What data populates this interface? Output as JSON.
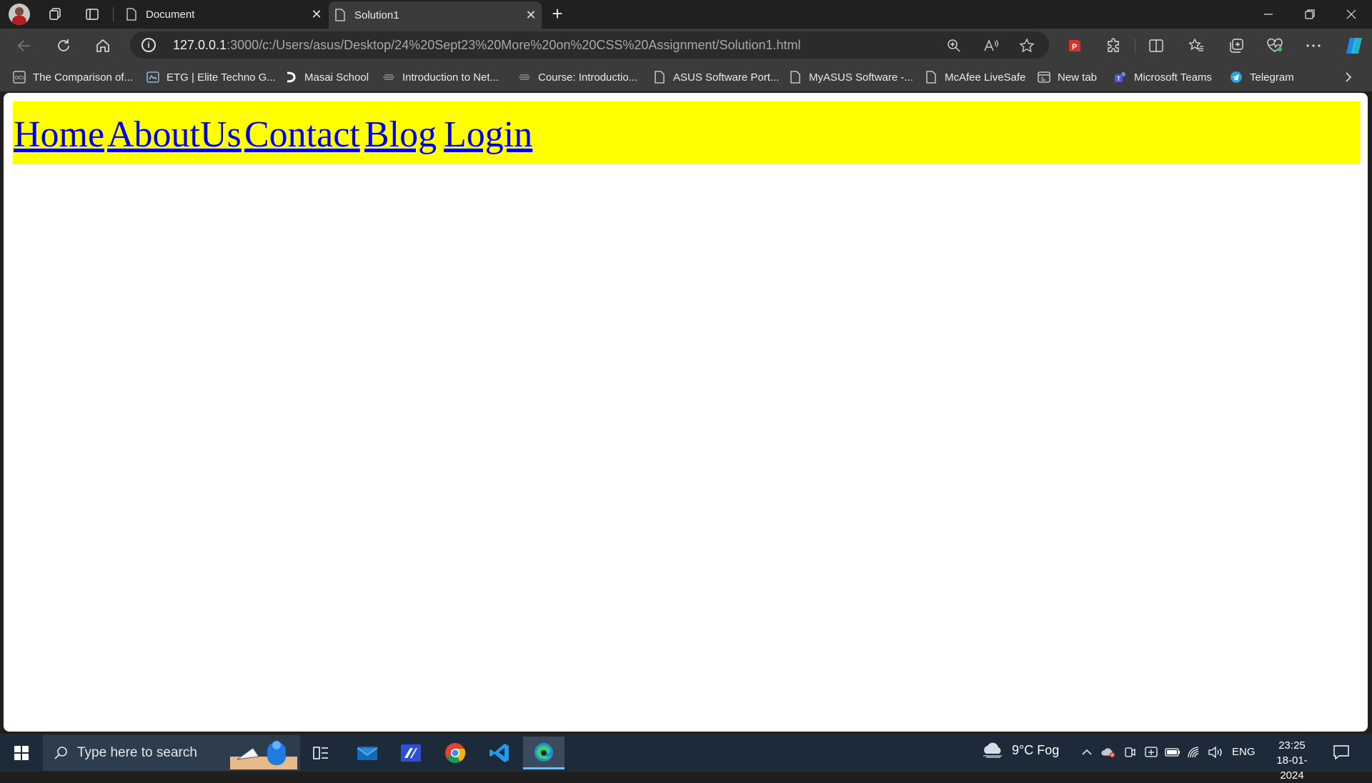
{
  "browser": {
    "tabs": [
      {
        "title": "Document",
        "active": false
      },
      {
        "title": "Solution1",
        "active": true
      }
    ],
    "address": {
      "host": "127.0.0.1",
      "path": ":3000/c:/Users/asus/Desktop/24%20Sept23%20More%20on%20CSS%20Assignment/Solution1.html"
    },
    "bookmarks": [
      {
        "label": "The Comparison of...",
        "icon": "dcu-icon"
      },
      {
        "label": "ETG | Elite Techno G...",
        "icon": "etg-icon"
      },
      {
        "label": "Masai School",
        "icon": "masai-icon"
      },
      {
        "label": "Introduction to Net...",
        "icon": "course-icon"
      },
      {
        "label": "Course: Introductio...",
        "icon": "course-icon"
      },
      {
        "label": "ASUS Software Port...",
        "icon": "page-icon"
      },
      {
        "label": "MyASUS Software -...",
        "icon": "page-icon"
      },
      {
        "label": "McAfee LiveSafe",
        "icon": "page-icon"
      },
      {
        "label": "New tab",
        "icon": "newtab-icon"
      },
      {
        "label": "Microsoft Teams",
        "icon": "teams-icon"
      },
      {
        "label": "Telegram",
        "icon": "telegram-icon"
      }
    ]
  },
  "page": {
    "nav_links": [
      "Home",
      "AboutUs",
      "Contact",
      "Blog",
      "Login"
    ],
    "nav_background": "#ffff00",
    "link_color": "#0000ee"
  },
  "taskbar": {
    "search_placeholder": "Type here to search",
    "weather": "9°C  Fog",
    "language": "ENG",
    "time": "23:25",
    "date": "18-01-2024"
  }
}
